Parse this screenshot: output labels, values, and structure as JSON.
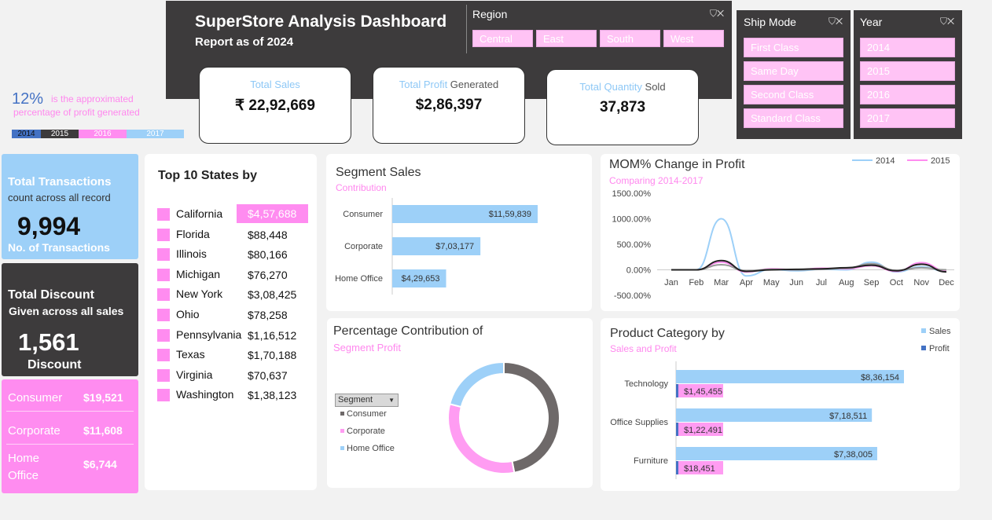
{
  "header": {
    "title": "SuperStore Analysis Dashboard",
    "subtitle": "Report as of 2024"
  },
  "region": {
    "title": "Region",
    "options": [
      "Central",
      "East",
      "South",
      "West"
    ]
  },
  "ship_mode": {
    "title": "Ship Mode",
    "options": [
      "First Class",
      "Same Day",
      "Second Class",
      "Standard Class"
    ]
  },
  "year": {
    "title": "Year",
    "options": [
      "2014",
      "2015",
      "2016",
      "2017"
    ]
  },
  "kpis": {
    "sales": {
      "label_a": "Total Sales",
      "label_b": "",
      "value": "₹ 22,92,669"
    },
    "profit": {
      "label_a": "Total Profit",
      "label_b": " Generated",
      "value": "$2,86,397"
    },
    "quantity": {
      "label_a": "Total Quantity",
      "label_b": " Sold",
      "value": "37,873"
    }
  },
  "profit_note": {
    "percent": "12%",
    "line1": "is the approximated",
    "line2": "percentage of profit generated",
    "years": [
      "2014",
      "2015",
      "2016",
      "2017"
    ],
    "year_colors": [
      "#4472c4",
      "#3d3b3c",
      "#ff8cf0",
      "#9dd0f8"
    ]
  },
  "transactions": {
    "title": "Total Transactions",
    "sub": "count across all record",
    "value": "9,994",
    "caption": "No. of Transactions"
  },
  "discount": {
    "title": "Total Discount",
    "sub": "Given across all sales",
    "value": "1,561",
    "caption": "Discount"
  },
  "segment_discount": [
    {
      "label": "Consumer",
      "value": "$19,521"
    },
    {
      "label": "Corporate",
      "value": "$11,608"
    },
    {
      "label": "Home Office",
      "value": "$6,744"
    }
  ],
  "top_states": {
    "title": "Top 10 States by",
    "rows": [
      {
        "state": "California",
        "value": "$4,57,688"
      },
      {
        "state": "Florida",
        "value": "$88,448"
      },
      {
        "state": "Illinois",
        "value": "$80,166"
      },
      {
        "state": "Michigan",
        "value": "$76,270"
      },
      {
        "state": "New York",
        "value": "$3,08,425"
      },
      {
        "state": "Ohio",
        "value": "$78,258"
      },
      {
        "state": "Pennsylvania",
        "value": "$1,16,512"
      },
      {
        "state": "Texas",
        "value": "$1,70,188"
      },
      {
        "state": "Virginia",
        "value": "$70,637"
      },
      {
        "state": "Washington",
        "value": "$1,38,123"
      }
    ]
  },
  "segment_sales_panel": {
    "title": "Segment Sales",
    "subtitle": "Contribution"
  },
  "mom_panel": {
    "title": "MOM% Change in Profit",
    "subtitle": "Comparing 2014-2017"
  },
  "donut_panel": {
    "title": "Percentage Contribution of",
    "subtitle": "Segment Profit",
    "filter_label": "Segment"
  },
  "product_panel": {
    "title": "Product Category by",
    "subtitle": "Sales and Profit"
  },
  "chart_data": [
    {
      "type": "bar",
      "orientation": "horizontal",
      "categories": [
        "Consumer",
        "Corporate",
        "Home Office"
      ],
      "values": [
        1159839,
        703177,
        429653
      ],
      "labels": [
        "$11,59,839",
        "$7,03,177",
        "$4,29,653"
      ],
      "color": "#9dd0f8"
    },
    {
      "type": "line",
      "x": [
        "Jan",
        "Feb",
        "Mar",
        "Apr",
        "May",
        "Jun",
        "Jul",
        "Aug",
        "Sep",
        "Oct",
        "Nov",
        "Dec"
      ],
      "yticks": [
        "1500.00%",
        "1000.00%",
        "500.00%",
        "0.00%",
        "-500.00%"
      ],
      "ylim": [
        -500,
        1500
      ],
      "series": [
        {
          "name": "2014",
          "color": "#9dd0f8",
          "values": [
            0,
            0,
            1000,
            -120,
            10,
            -20,
            10,
            0,
            150,
            -40,
            60,
            -30
          ]
        },
        {
          "name": "2015",
          "color": "#ff8cf0",
          "values": [
            0,
            0,
            150,
            -40,
            20,
            0,
            30,
            20,
            80,
            -30,
            140,
            -20
          ]
        },
        {
          "name": "",
          "color": "#999999",
          "values": [
            0,
            0,
            100,
            -20,
            10,
            0,
            10,
            30,
            120,
            -10,
            40,
            0
          ]
        },
        {
          "name": "",
          "color": "#222222",
          "values": [
            0,
            0,
            180,
            -30,
            0,
            10,
            20,
            40,
            90,
            -20,
            110,
            -40
          ]
        }
      ]
    },
    {
      "type": "pie",
      "style": "donut",
      "categories": [
        "Consumer",
        "Corporate",
        "Home Office"
      ],
      "values": [
        47,
        32,
        21
      ],
      "colors": [
        "#6e6969",
        "#ff9cf2",
        "#9dd0f8"
      ]
    },
    {
      "type": "bar",
      "orientation": "horizontal",
      "categories": [
        "Technology",
        "Office Supplies",
        "Furniture"
      ],
      "series": [
        {
          "name": "Sales",
          "color": "#9dd0f8",
          "values": [
            836154,
            718511,
            738005
          ],
          "labels": [
            "$8,36,154",
            "$7,18,511",
            "$7,38,005"
          ]
        },
        {
          "name": "Profit",
          "color": "#ff9cf2",
          "values": [
            145455,
            122491,
            18451
          ],
          "labels": [
            "$1,45,455",
            "$1,22,491",
            "$18,451"
          ]
        }
      ]
    }
  ]
}
